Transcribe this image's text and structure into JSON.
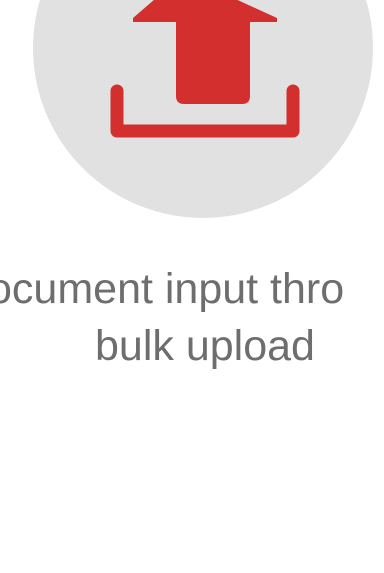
{
  "card": {
    "icon": "upload-tray-icon",
    "caption_line1": "ocument input thro",
    "caption_line2": "bulk upload"
  },
  "colors": {
    "circle_bg": "#e1e1e1",
    "accent_red": "#d32f2f",
    "caption_text": "#6e6e6e"
  }
}
